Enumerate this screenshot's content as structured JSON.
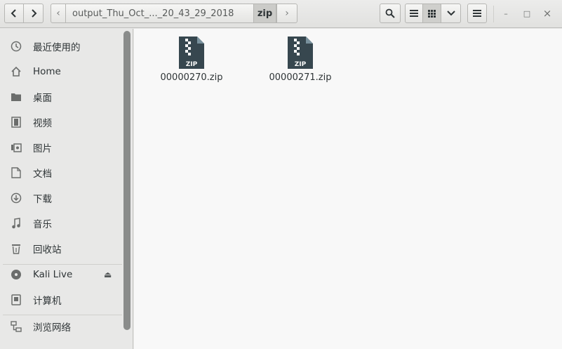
{
  "navigation": {
    "back_icon": "chevron-left-icon",
    "forward_icon": "chevron-right-icon"
  },
  "pathbar": {
    "left_arrow": "‹",
    "right_arrow": "›",
    "crumbs": [
      {
        "label": "output_Thu_Oct_..._20_43_29_2018",
        "current": false
      },
      {
        "label": "zip",
        "current": true
      }
    ]
  },
  "toolbar": {
    "search_icon": "search-icon",
    "list_view_icon": "list-view-icon",
    "grid_view_icon": "grid-view-icon",
    "view_options_icon": "chevron-down-icon",
    "menu_icon": "hamburger-menu-icon"
  },
  "window_controls": {
    "minimize": "–",
    "maximize": "□",
    "close": "×"
  },
  "sidebar": {
    "items": [
      {
        "label": "最近使用的",
        "icon": "recent-icon"
      },
      {
        "label": "Home",
        "icon": "home-icon"
      },
      {
        "label": "桌面",
        "icon": "desktop-folder-icon"
      },
      {
        "label": "视频",
        "icon": "video-icon"
      },
      {
        "label": "图片",
        "icon": "picture-icon"
      },
      {
        "label": "文档",
        "icon": "document-icon"
      },
      {
        "label": "下载",
        "icon": "download-icon"
      },
      {
        "label": "音乐",
        "icon": "music-icon"
      },
      {
        "label": "回收站",
        "icon": "trash-icon"
      }
    ],
    "devices": [
      {
        "label": "Kali Live",
        "icon": "disc-icon",
        "eject": "⏏"
      },
      {
        "label": "计算机",
        "icon": "drive-icon"
      }
    ],
    "network": [
      {
        "label": "浏览网络",
        "icon": "network-icon"
      }
    ]
  },
  "files": [
    {
      "name": "00000270.zip",
      "badge": "ZIP",
      "icon": "zip-file-icon"
    },
    {
      "name": "00000271.zip",
      "badge": "ZIP",
      "icon": "zip-file-icon"
    }
  ],
  "colors": {
    "zip_icon": "#37474f",
    "zip_fold": "#78909c",
    "content_bg": "#f8f8f8",
    "sidebar_bg": "#e8e8e7"
  }
}
